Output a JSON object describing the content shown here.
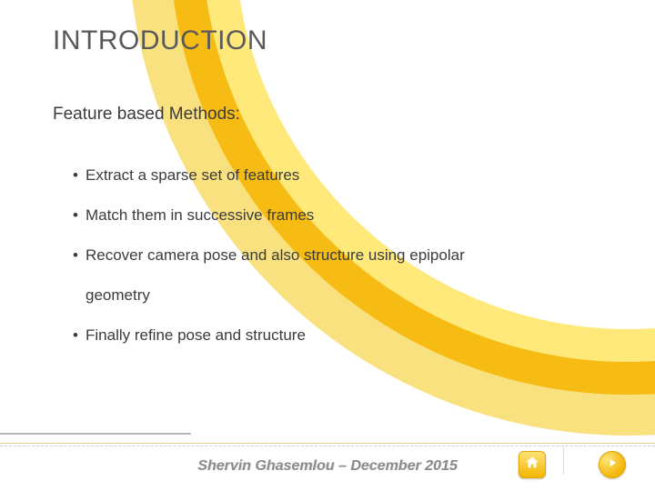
{
  "title": "INTRODUCTION",
  "subtitle": "Feature based Methods:",
  "bullets": [
    "Extract a sparse set of features",
    "Match them in successive frames",
    "Recover camera pose and also structure using epipolar",
    "Finally refine pose and structure"
  ],
  "bullet3_continuation": "geometry",
  "footer": {
    "author_line": "Shervin Ghasemlou – December 2015"
  },
  "icons": {
    "home": "home-icon",
    "next": "play-icon"
  }
}
